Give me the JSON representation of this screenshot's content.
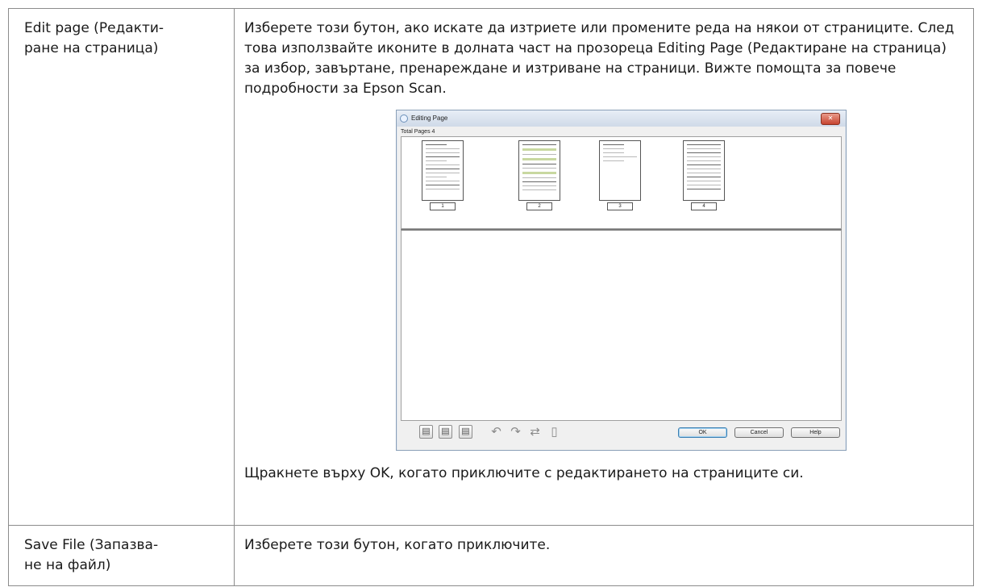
{
  "rows": [
    {
      "term": "Edit page (Редакти-\nране на страница)",
      "description": "Изберете този бутон, ако искате да изтриете или промените реда на някои от страниците. След това използвайте иконите в долната част на прозореца Editing Page (Редактиране на страница) за избор, завъртане, пренареждане и изтриване на страници. Вижте помощта за повече подробности за Epson Scan.",
      "note": "Щракнете върху OK, когато приключите с редактирането на страниците си."
    },
    {
      "term": "Save File (Запазва-\nне на файл)",
      "description": "Изберете този бутон, когато приключите."
    }
  ],
  "dialog": {
    "title": "Editing Page",
    "total_pages": "Total Pages 4",
    "pages": [
      "1",
      "2",
      "3",
      "4"
    ],
    "toolbar_icons": [
      "select-odd-pages-icon",
      "select-even-pages-icon",
      "select-all-pages-icon",
      "rotate-left-icon",
      "rotate-right-icon",
      "move-pages-icon",
      "delete-page-icon"
    ],
    "buttons": {
      "ok": "OK",
      "cancel": "Cancel",
      "help": "Help"
    }
  }
}
